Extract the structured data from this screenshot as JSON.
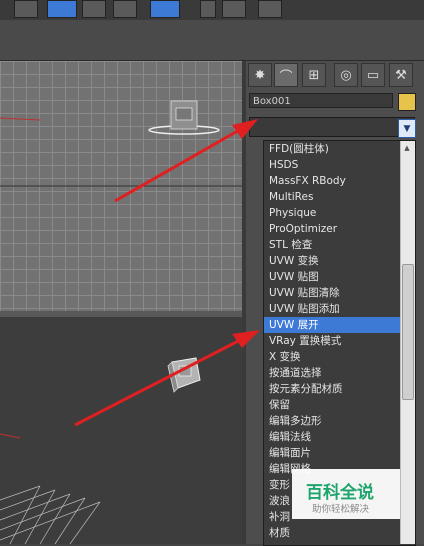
{
  "command_panel": {
    "object_name": "Box001",
    "object_color": "#e6c34b",
    "tabs": [
      "create-icon",
      "modify-icon",
      "hierarchy-icon",
      "motion-icon",
      "display-icon",
      "utilities-icon"
    ]
  },
  "modifier_list": {
    "current_value": "",
    "items": [
      "FFD(圆柱体)",
      "HSDS",
      "MassFX RBody",
      "MultiRes",
      "Physique",
      "ProOptimizer",
      "STL 检查",
      "UVW 变换",
      "UVW 贴图",
      "UVW 贴图清除",
      "UVW 贴图添加",
      "UVW 展开",
      "VRay 置换模式",
      "X 变换",
      "按通道选择",
      "按元素分配材质",
      "保留",
      "编辑多边形",
      "编辑法线",
      "编辑面片",
      "编辑网格",
      "变形",
      "波浪",
      "补洞",
      "材质"
    ],
    "selected_index": 11
  },
  "watermark": {
    "title": "百科全说",
    "subtitle": "助你轻松解决"
  },
  "colors": {
    "selection": "#3d7ad6",
    "arrow": "#e02020",
    "watermark_green": "#1fa56c"
  }
}
